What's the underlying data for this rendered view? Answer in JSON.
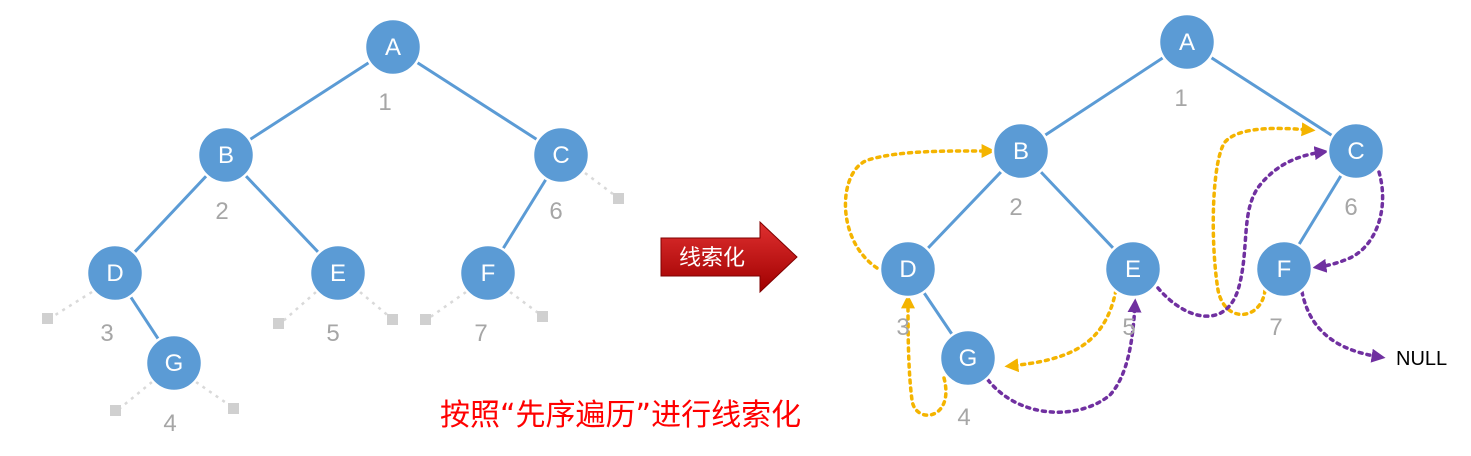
{
  "arrow_label": "线索化",
  "caption": "按照“先序遍历”进行线索化",
  "null_label": "NULL",
  "colors": {
    "node_fill": "#5b9bd5",
    "edge": "#5b9bd5",
    "order_number": "#a6a6a6",
    "predecessor_thread": "#f4b400",
    "successor_thread": "#7030a0",
    "caption": "#ff0000",
    "arrow": "#c00000"
  },
  "left_tree": {
    "nodes": [
      {
        "label": "A",
        "order": "1"
      },
      {
        "label": "B",
        "order": "2"
      },
      {
        "label": "C",
        "order": "6"
      },
      {
        "label": "D",
        "order": "3"
      },
      {
        "label": "E",
        "order": "5"
      },
      {
        "label": "F",
        "order": "7"
      },
      {
        "label": "G",
        "order": "4"
      }
    ]
  },
  "right_tree": {
    "nodes": [
      {
        "label": "A",
        "order": "1"
      },
      {
        "label": "B",
        "order": "2"
      },
      {
        "label": "C",
        "order": "6"
      },
      {
        "label": "D",
        "order": "3"
      },
      {
        "label": "E",
        "order": "5"
      },
      {
        "label": "F",
        "order": "7"
      },
      {
        "label": "G",
        "order": "4"
      }
    ]
  }
}
